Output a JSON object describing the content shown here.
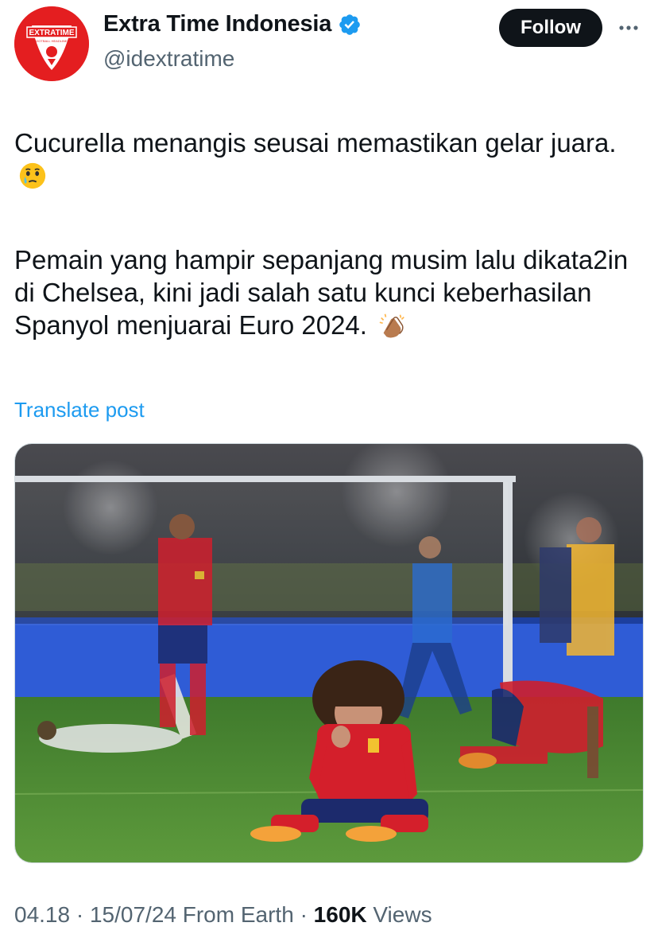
{
  "header": {
    "display_name": "Extra Time Indonesia",
    "handle": "@idextratime",
    "follow_label": "Follow",
    "avatar_text_top": "EXTRATIME",
    "avatar_text_bottom": "FOOTBALL HEADLINES",
    "verified_icon": "verified-badge-icon",
    "more_icon": "more-options-icon"
  },
  "tweet": {
    "paragraph1": "Cucurella menangis seusai memastikan gelar juara.",
    "paragraph1_emoji": "face-holding-back-tears-emoji",
    "paragraph2": "Pemain yang hampir sepanjang musim lalu dikata2in di Chelsea, kini jadi salah satu kunci keberhasilan Spanyol menjuarai Euro 2024.",
    "paragraph2_emoji": "clapping-hands-emoji",
    "translate_label": "Translate post"
  },
  "meta": {
    "time": "04.18",
    "date": "15/07/24",
    "source": "From Earth",
    "separator": "·",
    "views_count": "160K",
    "views_label": "Views"
  },
  "colors": {
    "accent": "#1d9bf0",
    "text_primary": "#0f1419",
    "text_secondary": "#536471",
    "avatar_bg": "#e41e20"
  }
}
